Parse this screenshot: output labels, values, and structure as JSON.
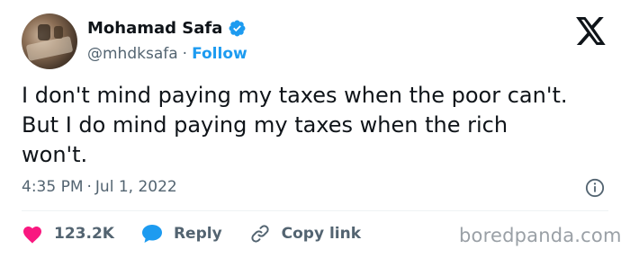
{
  "author": {
    "name": "Mohamad Safa",
    "handle": "@mhdksafa",
    "separator": "·",
    "follow_label": "Follow"
  },
  "tweet": {
    "lines": [
      "I don't mind paying my taxes when the poor can't.",
      "But I do mind paying my taxes when the rich",
      "won't."
    ]
  },
  "meta": {
    "time": "4:35 PM",
    "separator": "·",
    "date": "Jul 1, 2022"
  },
  "actions": {
    "likes": "123.2K",
    "reply_label": "Reply",
    "copy_label": "Copy link"
  },
  "watermark": "boredpanda.com",
  "icons": {
    "verified": "verified-badge-icon",
    "logo": "x-logo-icon",
    "info": "info-icon",
    "like": "heart-icon",
    "reply": "speech-bubble-icon",
    "copy": "link-icon"
  },
  "colors": {
    "accent": "#1d9bf0",
    "like": "#f91880",
    "secondary_text": "#536471",
    "primary_text": "#0f1419"
  }
}
